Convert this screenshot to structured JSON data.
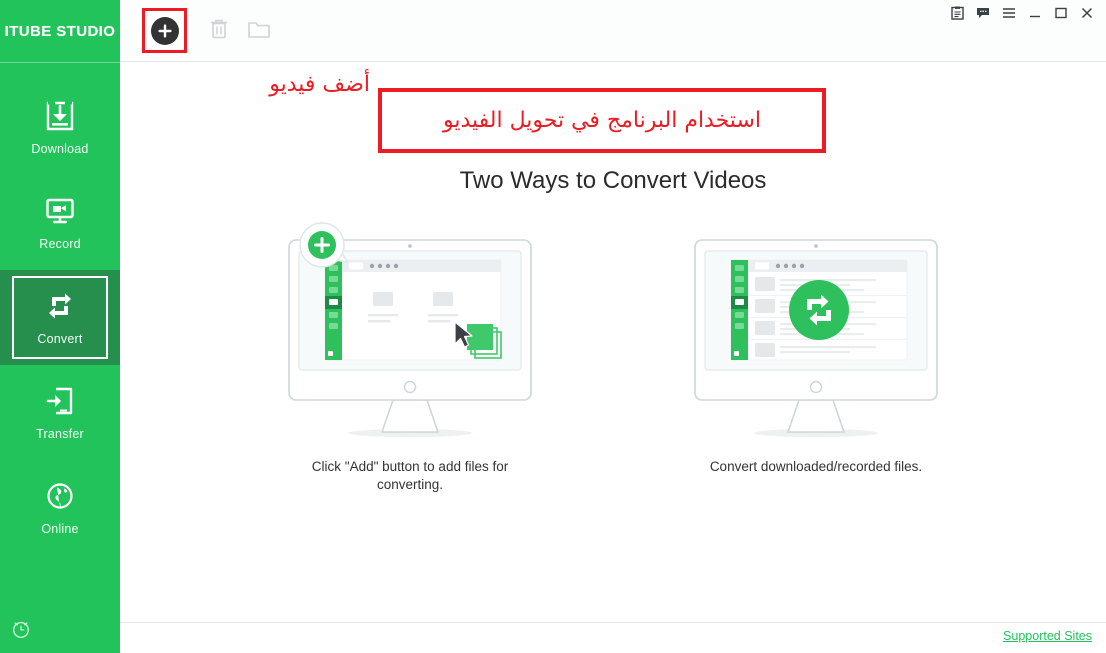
{
  "app": {
    "logo_text": "ITUBE STUDIO",
    "accent_green": "#22c35b",
    "active_green": "#268f4e",
    "annotation_red": "#ed1c24"
  },
  "titlebar": {
    "buttons": [
      {
        "name": "notes-icon",
        "tooltip": "Notes"
      },
      {
        "name": "feedback-icon",
        "tooltip": "Feedback"
      },
      {
        "name": "menu-icon",
        "tooltip": "Menu"
      },
      {
        "name": "minimize-icon",
        "tooltip": "Minimize"
      },
      {
        "name": "maximize-icon",
        "tooltip": "Maximize"
      },
      {
        "name": "close-icon",
        "tooltip": "Close"
      }
    ]
  },
  "sidebar": {
    "items": [
      {
        "label": "Download",
        "icon": "download-icon",
        "active": false
      },
      {
        "label": "Record",
        "icon": "record-icon",
        "active": false
      },
      {
        "label": "Convert",
        "icon": "convert-icon",
        "active": true
      },
      {
        "label": "Transfer",
        "icon": "transfer-icon",
        "active": false
      },
      {
        "label": "Online",
        "icon": "online-globe-icon",
        "active": false
      }
    ],
    "bottom_icon": "alarm-clock-icon"
  },
  "toolbar": {
    "add_button_label": "Add",
    "add_icon": "plus-circle-icon",
    "delete_icon": "trash-icon",
    "folder_icon": "folder-icon"
  },
  "annotations": {
    "add_video_label": "أضف فيديو",
    "banner_text": "استخدام البرنامج في تحويل الفيديو"
  },
  "main": {
    "headline": "Two Ways to Convert Videos",
    "cards": [
      {
        "art": "monitor-add-files-illustration",
        "caption": "Click \"Add\" button to add files for converting."
      },
      {
        "art": "monitor-convert-illustration",
        "caption": "Convert downloaded/recorded files."
      }
    ]
  },
  "footer": {
    "supported_sites_label": "Supported Sites"
  }
}
